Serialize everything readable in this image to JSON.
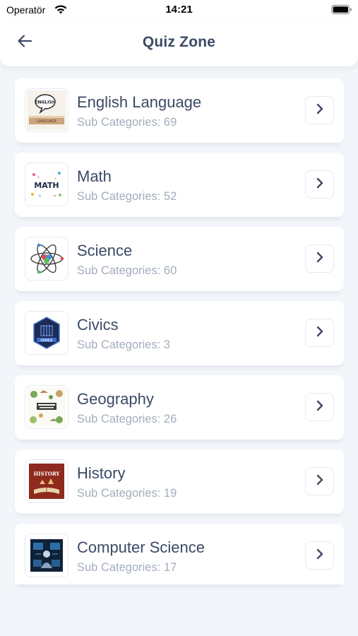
{
  "status_bar": {
    "carrier": "Operatör",
    "time": "14:21",
    "wifi_icon": "wifi-icon",
    "battery_icon": "battery-icon"
  },
  "header": {
    "title": "Quiz Zone",
    "back_icon": "arrow-left-icon"
  },
  "categories": [
    {
      "title": "English Language",
      "subtitle": "Sub Categories: 69",
      "thumb_text": "ENGLISH",
      "thumb_sub": "LANGUAGE"
    },
    {
      "title": "Math",
      "subtitle": "Sub Categories: 52",
      "thumb_text": "MATH"
    },
    {
      "title": "Science",
      "subtitle": "Sub Categories: 60"
    },
    {
      "title": "Civics",
      "subtitle": "Sub Categories: 3",
      "thumb_text": "CIVICS"
    },
    {
      "title": "Geography",
      "subtitle": "Sub Categories: 26"
    },
    {
      "title": "History",
      "subtitle": "Sub Categories: 19",
      "thumb_text": "HISTORY"
    },
    {
      "title": "Computer Science",
      "subtitle": "Sub Categories: 17"
    }
  ],
  "colors": {
    "background": "#f2f5f9",
    "card": "#ffffff",
    "title_text": "#3b4a66",
    "subtitle_text": "#a3adbd"
  }
}
